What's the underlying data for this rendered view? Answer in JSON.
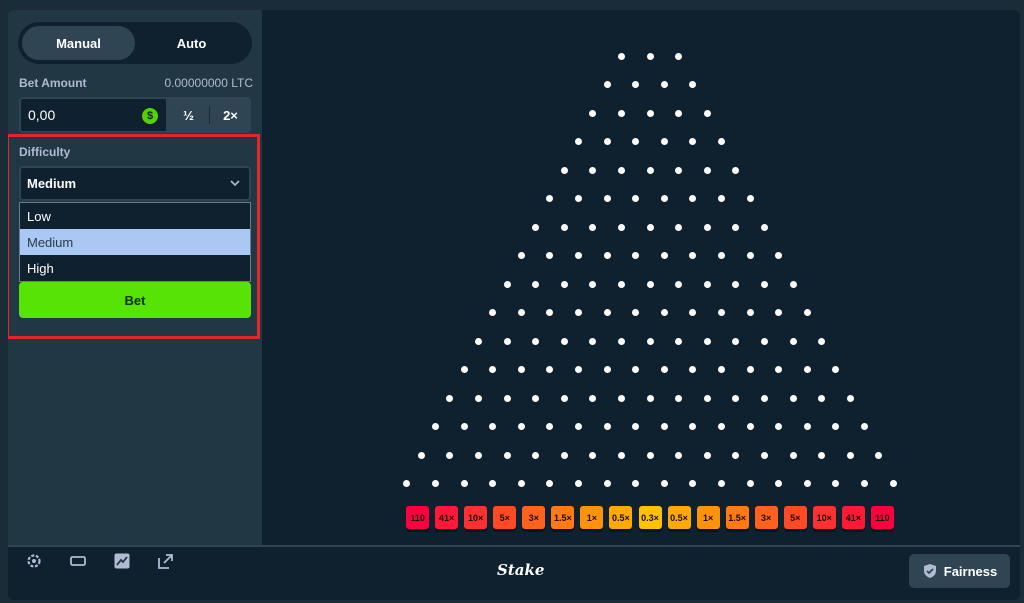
{
  "sidebar": {
    "tabs": [
      "Manual",
      "Auto"
    ],
    "active_tab": "Manual",
    "bet_amount_label": "Bet Amount",
    "bet_amount_value_display": "0.00000000 LTC",
    "bet_input_value": "0,00",
    "coin_symbol": "$",
    "half_label": "½",
    "double_label": "2×",
    "difficulty_label": "Difficulty",
    "difficulty_selected": "Medium",
    "difficulty_options": [
      "Low",
      "Medium",
      "High"
    ],
    "bet_button_label": "Bet"
  },
  "game": {
    "rows": 16,
    "multipliers": [
      "110",
      "41×",
      "10×",
      "5×",
      "3×",
      "1.5×",
      "1×",
      "0.5×",
      "0.3×",
      "0.5×",
      "1×",
      "1.5×",
      "3×",
      "5×",
      "10×",
      "41×",
      "110"
    ],
    "multiplier_colors": [
      "#ff003f",
      "#ff1837",
      "#ff302f",
      "#ff4a25",
      "#ff621c",
      "#ff7a13",
      "#ff920b",
      "#ffaa04",
      "#ffc000",
      "#ffaa04",
      "#ff920b",
      "#ff7a13",
      "#ff621c",
      "#ff4a25",
      "#ff302f",
      "#ff1837",
      "#ff003f"
    ]
  },
  "footer": {
    "icons": [
      "gear-icon",
      "theater-mode-icon",
      "stats-chart-icon",
      "popout-icon"
    ],
    "brand": "Stake",
    "fairness_label": "Fairness"
  },
  "colors": {
    "accent_green": "#57e303",
    "highlight_red": "#e3262a"
  }
}
